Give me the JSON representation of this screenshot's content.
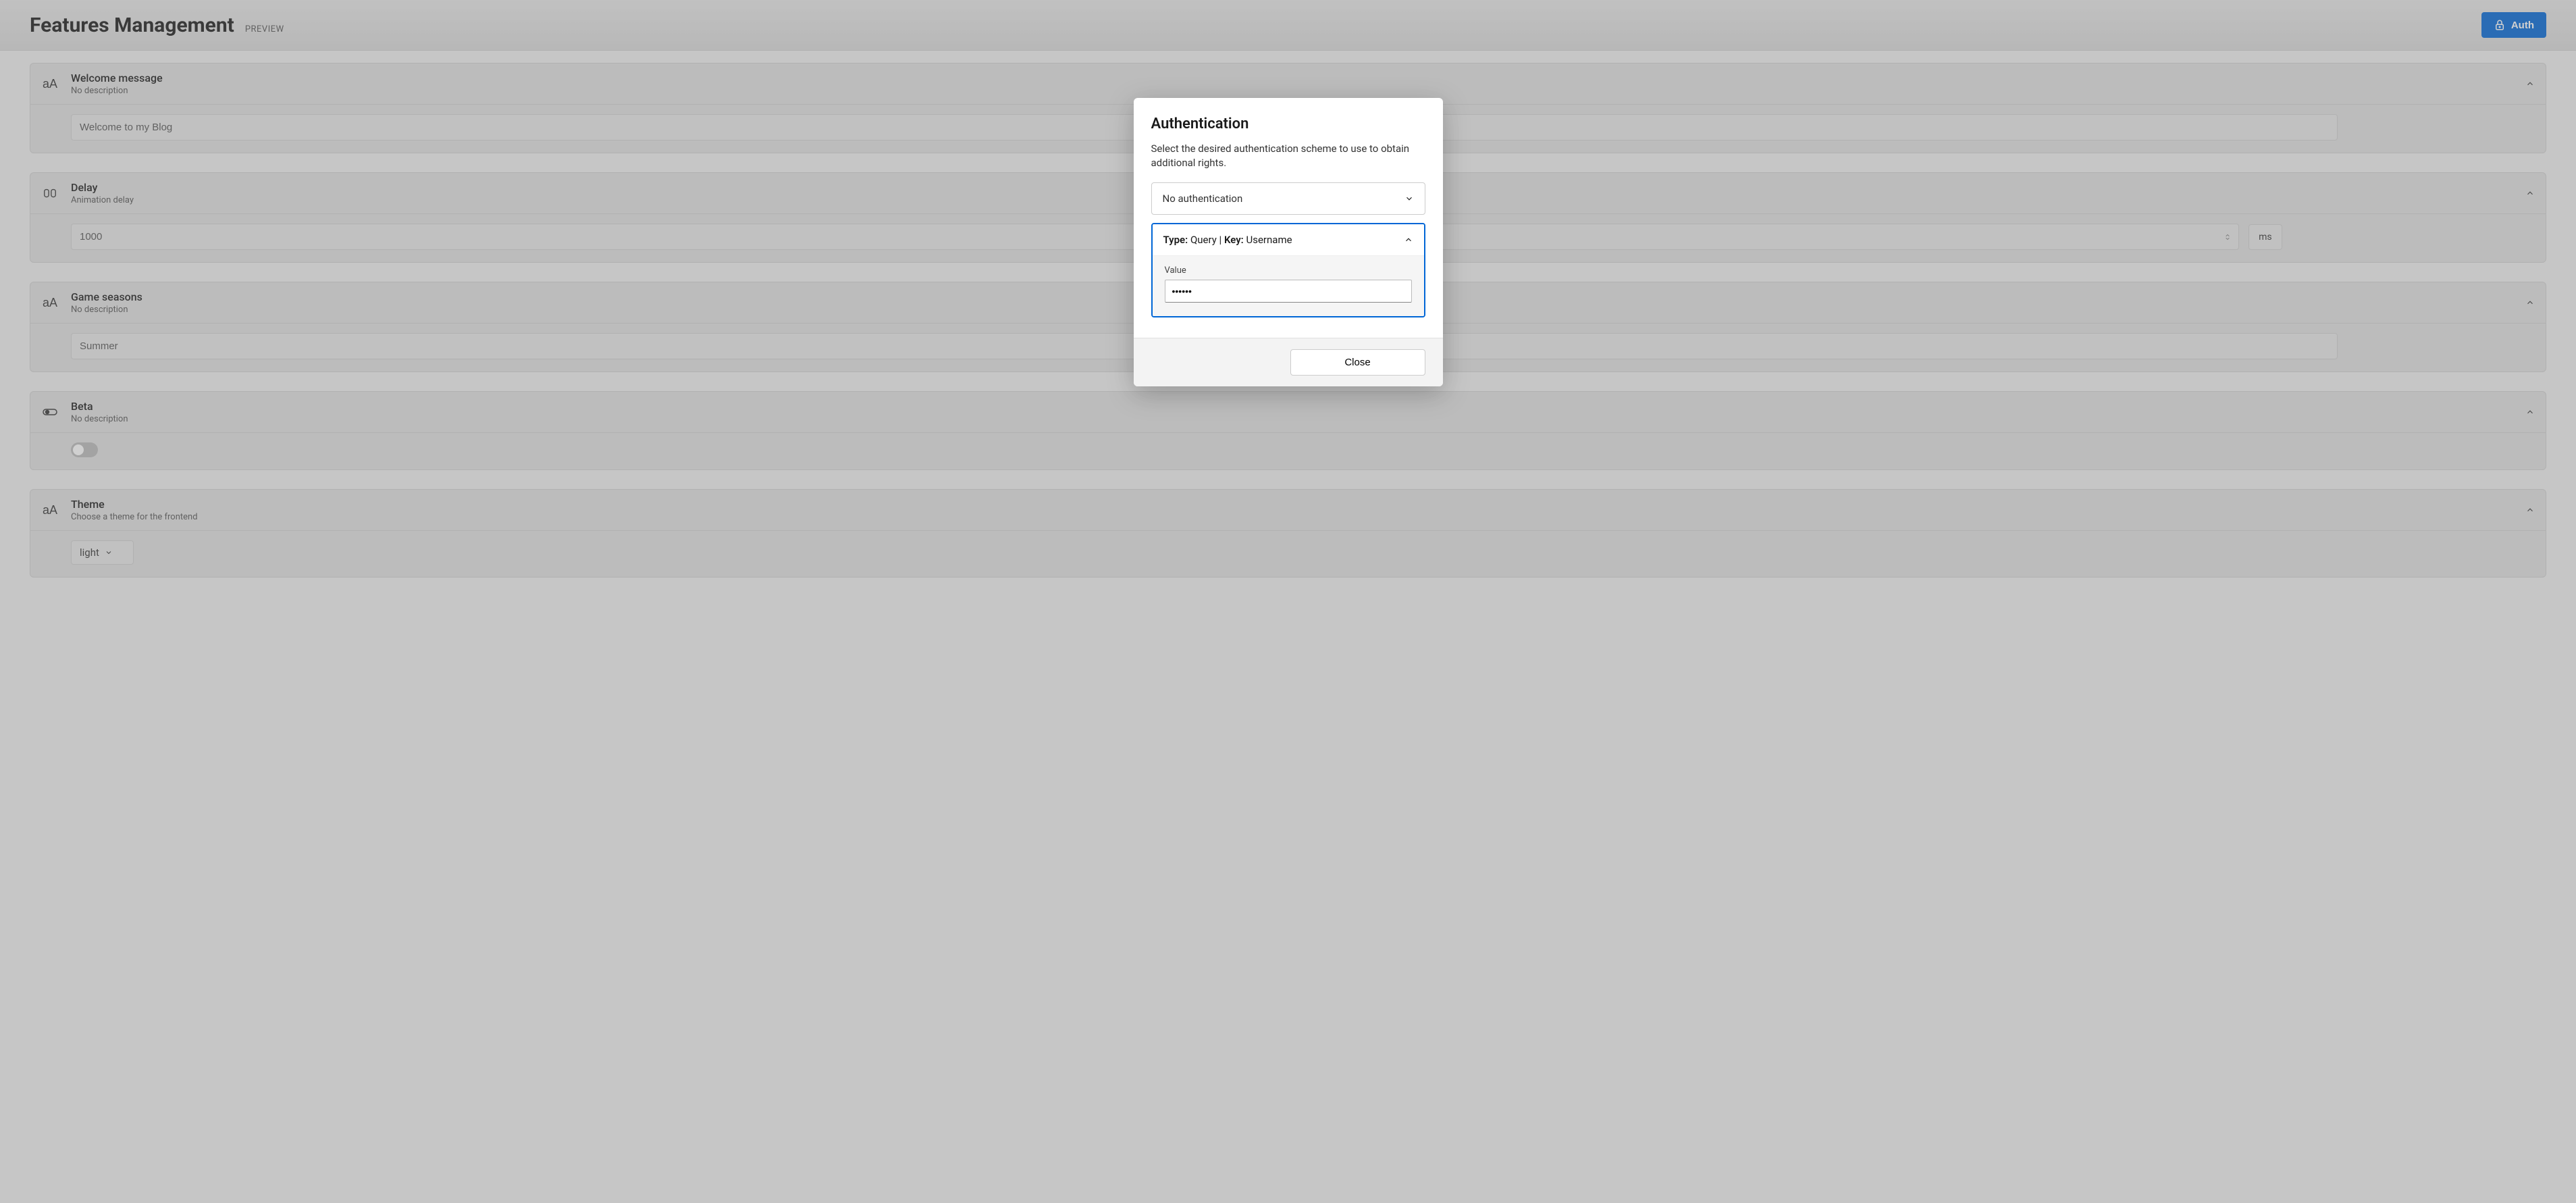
{
  "header": {
    "title": "Features Management",
    "badge": "PREVIEW",
    "auth_button": "Auth"
  },
  "features": [
    {
      "title": "Welcome message",
      "desc": "No description",
      "value": "Welcome to my Blog"
    },
    {
      "title": "Delay",
      "desc": "Animation delay",
      "value": "1000",
      "unit": "ms"
    },
    {
      "title": "Game seasons",
      "desc": "No description",
      "value": "Summer"
    },
    {
      "title": "Beta",
      "desc": "No description",
      "toggle": false
    },
    {
      "title": "Theme",
      "desc": "Choose a theme for the frontend",
      "value": "light"
    }
  ],
  "modal": {
    "title": "Authentication",
    "desc": "Select the desired authentication scheme to use to obtain additional rights.",
    "scheme_select": "No authentication",
    "panel": {
      "type_label": "Type:",
      "type_value": "Query",
      "separator": "|",
      "key_label": "Key:",
      "key_value": "Username",
      "value_label": "Value",
      "value_mask": "******"
    },
    "close_button": "Close"
  }
}
